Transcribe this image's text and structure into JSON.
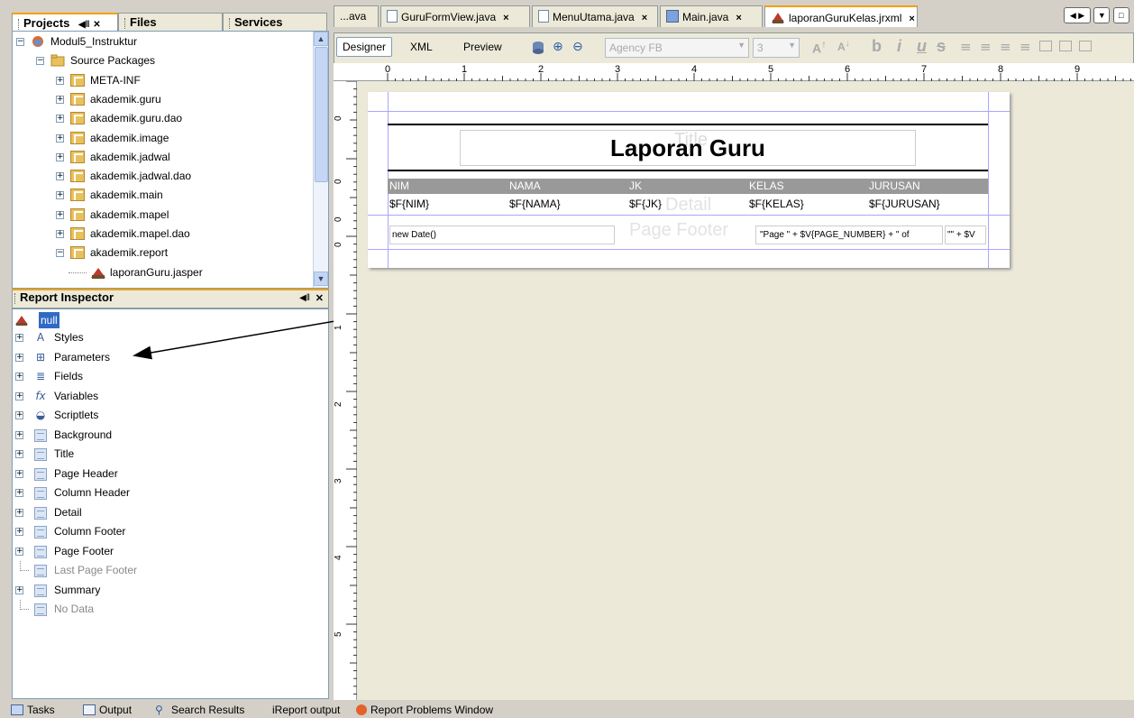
{
  "projects_panel": {
    "tabs": [
      "Projects",
      "Files",
      "Services"
    ],
    "tree": [
      {
        "label": "Modul5_Instruktur",
        "level": 0,
        "type": "project",
        "expanded": true
      },
      {
        "label": "Source Packages",
        "level": 1,
        "type": "folder",
        "expanded": true
      },
      {
        "label": "META-INF",
        "level": 2,
        "type": "package"
      },
      {
        "label": "akademik.guru",
        "level": 2,
        "type": "package"
      },
      {
        "label": "akademik.guru.dao",
        "level": 2,
        "type": "package"
      },
      {
        "label": "akademik.image",
        "level": 2,
        "type": "package"
      },
      {
        "label": "akademik.jadwal",
        "level": 2,
        "type": "package"
      },
      {
        "label": "akademik.jadwal.dao",
        "level": 2,
        "type": "package"
      },
      {
        "label": "akademik.main",
        "level": 2,
        "type": "package"
      },
      {
        "label": "akademik.mapel",
        "level": 2,
        "type": "package"
      },
      {
        "label": "akademik.mapel.dao",
        "level": 2,
        "type": "package"
      },
      {
        "label": "akademik.report",
        "level": 2,
        "type": "package",
        "expanded": true
      },
      {
        "label": "laporanGuru.jasper",
        "level": 3,
        "type": "jasper"
      }
    ]
  },
  "inspector": {
    "title": "Report Inspector",
    "root": "null",
    "items": [
      {
        "label": "Styles",
        "icon": "styles-icon",
        "expandable": true
      },
      {
        "label": "Parameters",
        "icon": "parameters-icon",
        "expandable": true
      },
      {
        "label": "Fields",
        "icon": "fields-icon",
        "expandable": true
      },
      {
        "label": "Variables",
        "icon": "variables-icon",
        "expandable": true
      },
      {
        "label": "Scriptlets",
        "icon": "scriptlets-icon",
        "expandable": true
      },
      {
        "label": "Background",
        "icon": "band-icon",
        "expandable": true
      },
      {
        "label": "Title",
        "icon": "band-icon",
        "expandable": true
      },
      {
        "label": "Page Header",
        "icon": "band-icon",
        "expandable": true
      },
      {
        "label": "Column Header",
        "icon": "band-icon",
        "expandable": true
      },
      {
        "label": "Detail",
        "icon": "band-icon",
        "expandable": true
      },
      {
        "label": "Column Footer",
        "icon": "band-icon",
        "expandable": true
      },
      {
        "label": "Page Footer",
        "icon": "band-icon",
        "expandable": true
      },
      {
        "label": "Last Page Footer",
        "icon": "band-icon",
        "expandable": false,
        "disabled": true
      },
      {
        "label": "Summary",
        "icon": "band-icon",
        "expandable": true
      },
      {
        "label": "No Data",
        "icon": "band-icon",
        "expandable": false,
        "disabled": true
      }
    ]
  },
  "editor_tabs": [
    {
      "label": "...ava",
      "icon": "none"
    },
    {
      "label": "GuruFormView.java",
      "icon": "java-file-icon"
    },
    {
      "label": "MenuUtama.java",
      "icon": "java-file-icon"
    },
    {
      "label": "Main.java",
      "icon": "main-class-icon"
    },
    {
      "label": "laporanGuruKelas.jrxml",
      "icon": "report-icon",
      "active": true
    }
  ],
  "toolbar": {
    "designer": "Designer",
    "xml": "XML",
    "preview": "Preview",
    "font": "Agency FB",
    "size": "3",
    "b": "b",
    "i": "i",
    "u": "u"
  },
  "ruler_numbers": [
    "0",
    "1",
    "2",
    "3",
    "4",
    "5",
    "6",
    "7",
    "8",
    "9"
  ],
  "vruler_numbers": [
    "0",
    "0",
    "0",
    "0",
    "1",
    "2",
    "3",
    "4",
    "5"
  ],
  "report": {
    "title_band_label": "Title",
    "title_text": "Laporan Guru",
    "columns": [
      "NIM",
      "NAMA",
      "JK",
      "KELAS",
      "JURUSAN"
    ],
    "detail_band_label": "Detail",
    "fields": [
      "$F{NIM}",
      "$F{NAMA}",
      "$F{JK}",
      "$F{KELAS}",
      "$F{JURUSAN}"
    ],
    "footer_band_label": "Page Footer",
    "footer_date": "new Date()",
    "footer_page": "\"Page \" + $V{PAGE_NUMBER} + \" of",
    "footer_total": "\"\" + $V"
  },
  "bottom_bar": [
    {
      "label": "Tasks",
      "icon": "tasks-icon"
    },
    {
      "label": "Output",
      "icon": "output-icon"
    },
    {
      "label": "Search Results",
      "icon": "search-icon"
    },
    {
      "label": "iReport output",
      "icon": "none"
    },
    {
      "label": "Report Problems Window",
      "icon": "problems-icon"
    }
  ]
}
